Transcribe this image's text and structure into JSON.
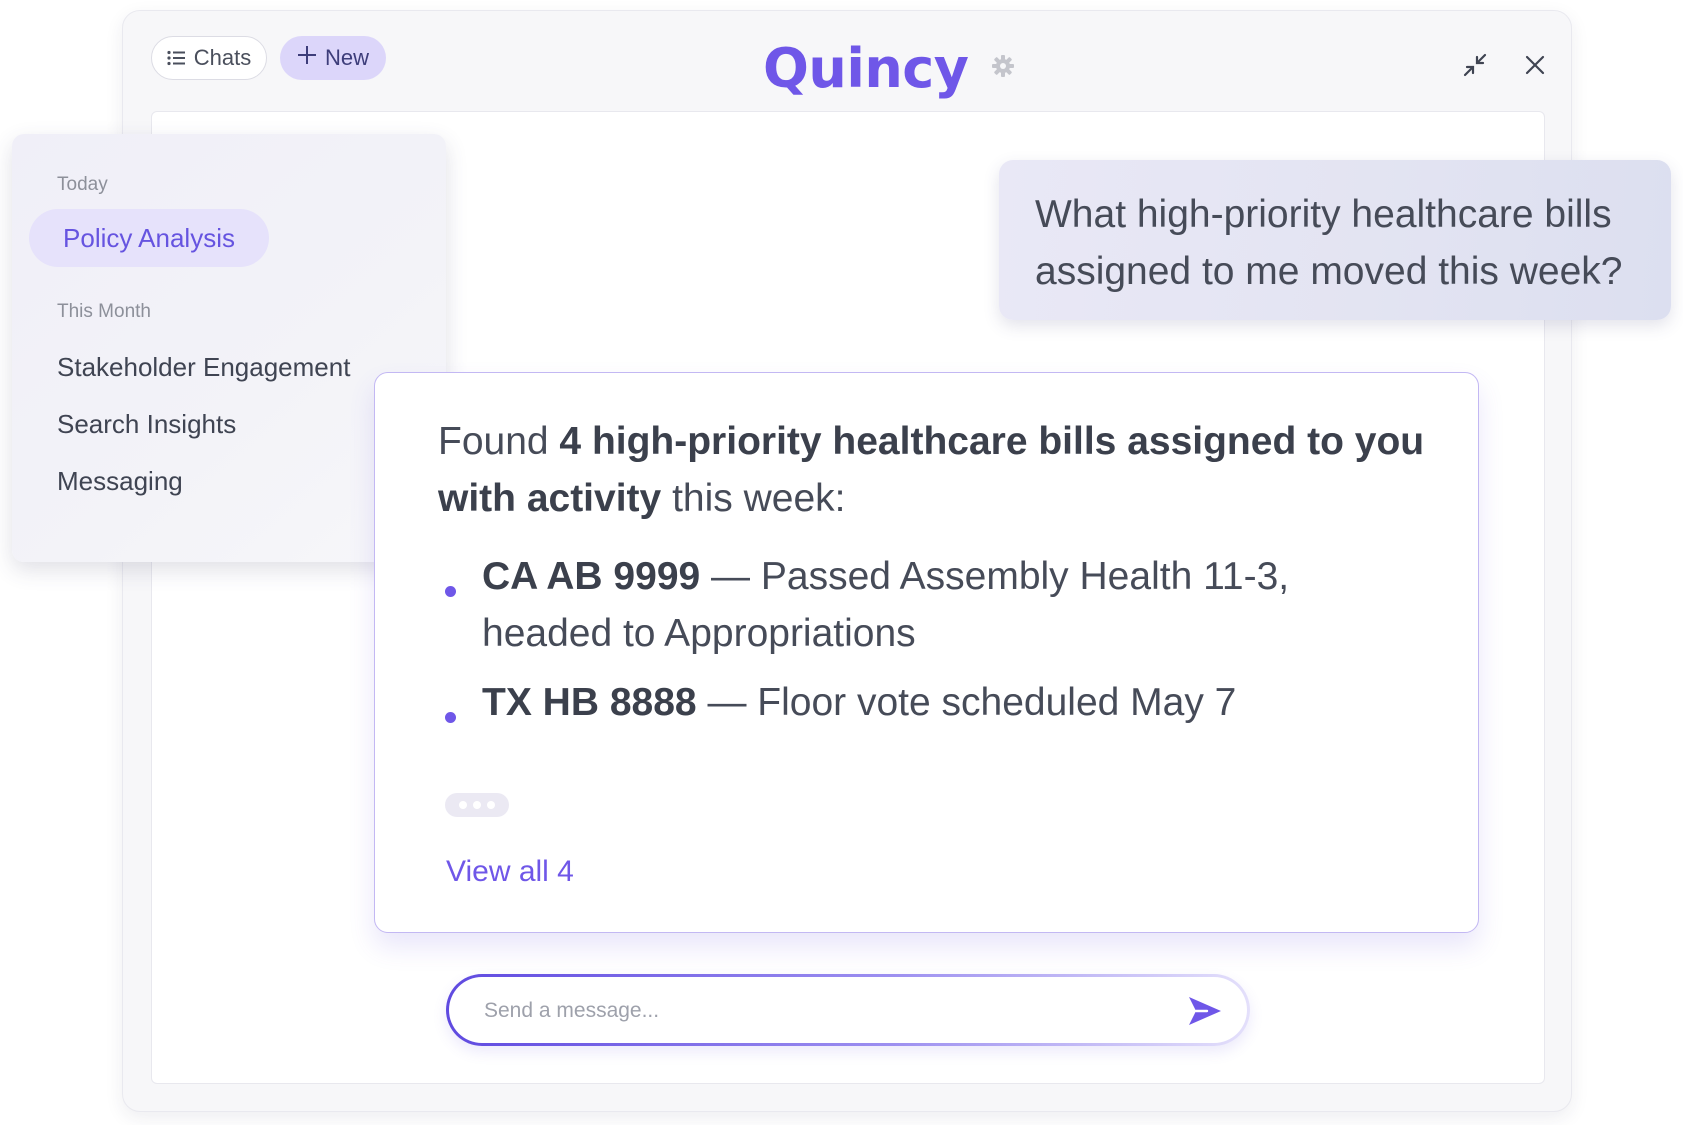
{
  "header": {
    "chats_label": "Chats",
    "new_label": "New",
    "app_title": "Quincy"
  },
  "icons": {
    "chats": "list-icon",
    "new": "plus-icon",
    "settings": "gear-icon",
    "collapse": "collapse-icon",
    "close": "close-icon",
    "send": "send-icon"
  },
  "sidebar": {
    "today_label": "Today",
    "today_items": [
      {
        "label": "Policy Analysis",
        "active": true
      }
    ],
    "month_label": "This Month",
    "month_items": [
      {
        "label": "Stakeholder Engagement"
      },
      {
        "label": "Search Insights"
      },
      {
        "label": "Messaging"
      }
    ]
  },
  "conversation": {
    "user_question": "What high-priority healthcare bills assigned to me moved this week?",
    "answer": {
      "intro_prefix": "Found ",
      "intro_bold": "4 high-priority healthcare bills assigned to you with activity",
      "intro_suffix": " this week:",
      "bills": [
        {
          "id": "CA AB 9999",
          "separator": " — ",
          "status": "Passed Assembly Health 11-3, headed to Appropriations"
        },
        {
          "id": "TX HB 8888",
          "separator": " — ",
          "status": "Floor vote scheduled May 7"
        }
      ],
      "view_all_label": "View all 4"
    }
  },
  "composer": {
    "placeholder": "Send a message...",
    "value": ""
  },
  "colors": {
    "accent": "#6f57e8",
    "accent_light": "#dcd6fa",
    "text": "#464b58",
    "muted": "#8d909a"
  }
}
